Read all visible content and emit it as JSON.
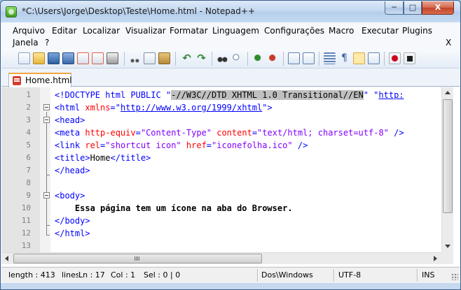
{
  "window": {
    "title": "*C:\\Users\\Jorge\\Desktop\\Teste\\Home.html - Notepad++",
    "minimize_label": "─",
    "maximize_label": "□",
    "close_label": "X"
  },
  "menu": {
    "items": [
      "Arquivo",
      "Editar",
      "Localizar",
      "Visualizar",
      "Formatar",
      "Linguagem",
      "Configurações",
      "Macro",
      "Executar",
      "Plugins",
      "Janela",
      "?"
    ],
    "close_document": "X"
  },
  "toolbar": {
    "icons": [
      "new-file-icon",
      "open-file-icon",
      "save-icon",
      "save-all-icon",
      "close-icon",
      "close-all-icon",
      "print-icon",
      "cut-icon",
      "copy-icon",
      "paste-icon",
      "undo-icon",
      "redo-icon",
      "find-icon",
      "replace-icon",
      "zoom-in-icon",
      "zoom-out-icon",
      "sync-vertical-icon",
      "sync-horizontal-icon",
      "word-wrap-icon",
      "show-all-chars-icon",
      "indent-guide-icon",
      "user-language-icon",
      "record-macro-icon",
      "stop-record-icon"
    ]
  },
  "tabs": [
    {
      "label": "Home.html",
      "active": true
    }
  ],
  "editor": {
    "lines": [
      {
        "n": "1"
      },
      {
        "n": "2"
      },
      {
        "n": "3"
      },
      {
        "n": "4"
      },
      {
        "n": "5"
      },
      {
        "n": "6"
      },
      {
        "n": "7"
      },
      {
        "n": "8"
      },
      {
        "n": "9"
      },
      {
        "n": "10"
      },
      {
        "n": "11"
      },
      {
        "n": "12"
      },
      {
        "n": "13"
      }
    ],
    "code": {
      "l1_a": "<!DOCTYPE html PUBLIC \"",
      "l1_b": "-//W3C//DTD XHTML 1.0 Transitional//EN",
      "l1_c": "\" \"",
      "l1_d": "http:",
      "l2_tag": "<html ",
      "l2_attr": "xmlns",
      "l2_eq": "=\"",
      "l2_url": "http://www.w3.org/1999/xhtml",
      "l2_end": "\">",
      "l3": "<head>",
      "l4_tag": "<meta ",
      "l4_attr1": "http-equiv",
      "l4_eq1": "=",
      "l4_str1": "\"Content-Type\"",
      "l4_sp": " ",
      "l4_attr2": "content",
      "l4_eq2": "=",
      "l4_str2": "\"text/html; charset=utf-8\"",
      "l4_end": " />",
      "l5_tag": "<link ",
      "l5_attr1": "rel",
      "l5_eq1": "=",
      "l5_str1": "\"shortcut icon\"",
      "l5_sp": " ",
      "l5_attr2": "href",
      "l5_eq2": "=",
      "l5_str2": "\"iconefolha.ico\"",
      "l5_end": " />",
      "l6_open": "<title>",
      "l6_text": "Home",
      "l6_close": "</title>",
      "l7": "</head>",
      "l9": "<body>",
      "l10": "    Essa página tem um ícone na aba do Browser.",
      "l11": "</body>",
      "l12": "</html>"
    },
    "current_line": "13"
  },
  "statusbar": {
    "length": "length : 413",
    "lines": "lines",
    "ln": "Ln : 17",
    "col": "Col : 1",
    "sel": "Sel : 0 | 0",
    "eol": "Dos\\Windows",
    "encoding": "UTF-8",
    "mode": "INS"
  },
  "colors": {
    "tag": "#0000ff",
    "attribute": "#ff0000",
    "string": "#8000ff",
    "selection": "#c0c0c0",
    "current_line": "#e8e8ff"
  }
}
